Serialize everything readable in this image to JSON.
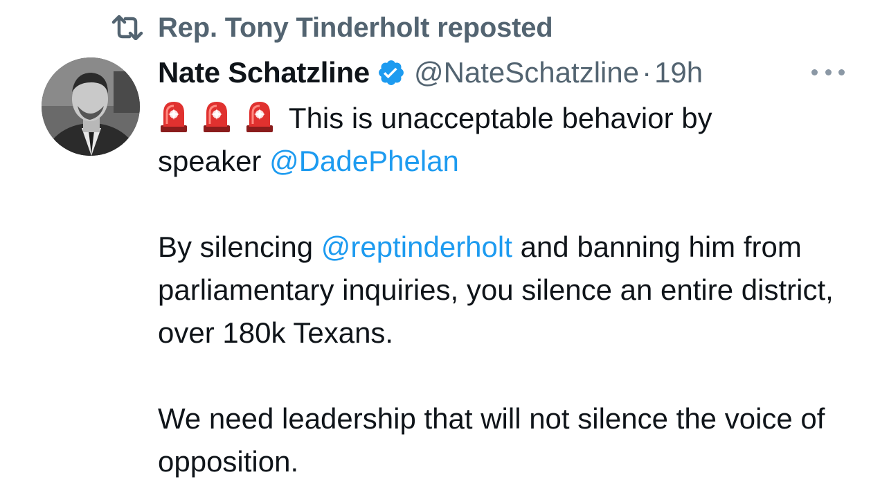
{
  "repost": {
    "icon": "repost-icon",
    "label": "Rep. Tony Tinderholt reposted"
  },
  "tweet": {
    "author": {
      "name": "Nate Schatzline",
      "handle": "@NateSchatzline",
      "verified_icon": "verified-badge-icon",
      "avatar": "profile-photo"
    },
    "separator": "·",
    "time": "19h",
    "more_icon": "more-options-icon",
    "emoji_icon": "police-siren-emoji",
    "line1_text": " This is unacceptable behavior by",
    "line2_prefix": "speaker ",
    "mention1": "@DadePhelan",
    "para2_prefix": "By silencing ",
    "mention2": "@reptinderholt",
    "para2_rest": " and banning him from parliamentary inquiries, you silence an entire district, over 180k Texans.",
    "para3": "We need leadership that will not silence the voice of opposition."
  },
  "colors": {
    "text": "#0f1419",
    "secondary": "#536471",
    "link": "#1d9bf0",
    "verified": "#1d9bf0",
    "siren": "#e0312f"
  }
}
